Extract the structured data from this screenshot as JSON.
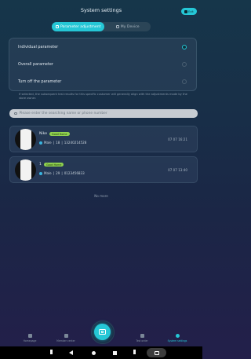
{
  "header": {
    "title": "System settings",
    "exit_label": "Exit"
  },
  "tabs": [
    {
      "label": "Parameter adjustment",
      "active": true
    },
    {
      "label": "My Device",
      "active": false
    }
  ],
  "options": [
    {
      "label": "Individual parameter",
      "selected": true
    },
    {
      "label": "Overall parameter",
      "selected": false
    },
    {
      "label": "Turn off the parameter",
      "selected": false
    }
  ],
  "note": "If selected, the subsequent test results for this specific customer will generally align with the adjustments made by the store owner.",
  "search": {
    "placeholder": "Please enter the searching name or phone number"
  },
  "customers": [
    {
      "name": "Nike",
      "badge": "Good Home",
      "gender": "Male",
      "age": "18",
      "phone": "13240214528",
      "time": "07 07 16:21"
    },
    {
      "name": "1",
      "badge": "Good Home",
      "gender": "Male",
      "age": "29",
      "phone": "0123456833",
      "time": "07 07 13:40"
    }
  ],
  "no_more": "No more",
  "bottom_nav": [
    {
      "label": "Homepage",
      "icon": "home-icon",
      "active": false
    },
    {
      "label": "Member center",
      "icon": "member-icon",
      "active": false
    },
    {
      "label": "Test order",
      "icon": "order-icon",
      "active": false
    },
    {
      "label": "System settings",
      "icon": "settings-icon",
      "active": true
    }
  ],
  "accent_color": "#25c7d6",
  "badge_color": "#8fd14f"
}
